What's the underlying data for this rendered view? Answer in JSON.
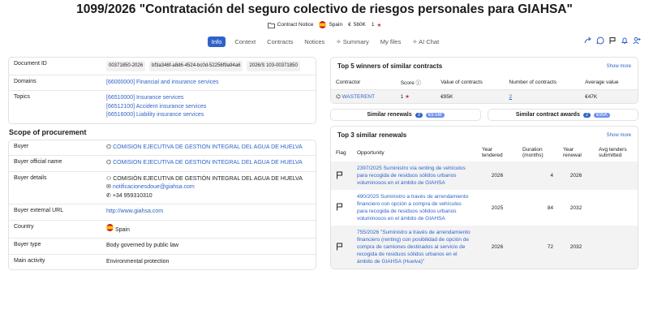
{
  "title": "1099/2026 \"Contratación del seguro colectivo de riesgos personales para GIAHSA\"",
  "meta": {
    "type": "Contract Notice",
    "country": "Spain",
    "value": "560K",
    "score": "1"
  },
  "tabs": [
    "Info",
    "Context",
    "Contracts",
    "Notices",
    "Summary",
    "My files",
    "AI Chat"
  ],
  "details": {
    "document_id": {
      "label": "Document ID",
      "ids": [
        "00371850-2026",
        "bf3a346f-a8d6-4524-bc0d-52256f9a94a6",
        "2026/S 103-00371850"
      ]
    },
    "domains": {
      "label": "Domains",
      "value": "[66000000] Financial and insurance services"
    },
    "topics": {
      "label": "Topics",
      "values": [
        "[66510000] Insurance services",
        "[66512100] Accident insurance services",
        "[66516000] Liability insurance services"
      ]
    }
  },
  "scope": {
    "title": "Scope of procurement",
    "buyer": {
      "label": "Buyer",
      "value": "COMISION EJECUTIVA DE GESTION INTEGRAL DEL AGUA DE HUELVA"
    },
    "buyer_official": {
      "label": "Buyer official name",
      "value": "COMISION EJECUTIVA DE GESTION INTEGRAL DEL AGUA DE HUELVA"
    },
    "buyer_details": {
      "label": "Buyer details",
      "name": "COMISIÓN EJECUTIVA DE GESTIÓN INTEGRAL DEL AGUA DE HUELVA",
      "email": "notificacionesdoue@giahsa.com",
      "phone": "+34 959310310"
    },
    "buyer_url": {
      "label": "Buyer external URL",
      "value": "http://www.giahsa.com"
    },
    "country": {
      "label": "Country",
      "value": "Spain"
    },
    "buyer_type": {
      "label": "Buyer type",
      "value": "Body governed by public law"
    },
    "activity": {
      "label": "Main activity",
      "value": "Environmental protection"
    }
  },
  "winners": {
    "title": "Top 5 winners of similar contracts",
    "show_more": "Show more",
    "columns": [
      "Contractor",
      "Score",
      "Value of contracts",
      "Number of contracts",
      "Average value"
    ],
    "rows": [
      {
        "contractor": "WASTERENT",
        "score": "1",
        "value": "€95K",
        "count": "2",
        "avg": "€47K"
      }
    ]
  },
  "similar": {
    "renewals": {
      "label": "Similar renewals",
      "count": "3",
      "amount": "€9.5M"
    },
    "awards": {
      "label": "Similar contract awards",
      "count": "2",
      "amount": "€95K"
    }
  },
  "renewals": {
    "title": "Top 3 similar renewals",
    "show_more": "Show more",
    "columns": [
      "Flag",
      "Opportunity",
      "Year tendered",
      "Duration (months)",
      "Year renewal",
      "Avg tenders submitted"
    ],
    "rows": [
      {
        "opportunity": "2397/2025 Suministro vía renting de vehículos para recogida de residuos sólidos urbanos voluminosos en el ámbito de GIAHSA",
        "year": "2026",
        "duration": "4",
        "renewal": "2026",
        "avg": ""
      },
      {
        "opportunity": "490/2025 Suministro a través de arrendamiento financiero con opción a compra de vehículos para recogida de residuos sólidos urbanos voluminosos en el ámbito de GIAHSA",
        "year": "2025",
        "duration": "84",
        "renewal": "2032",
        "avg": ""
      },
      {
        "opportunity": "755/2026 \"Suministro a través de arrendamiento financiero (renting) con posibilidad de opción de compra de camiones destinados al servicio de recogida de residuos sólidos urbanos en el ámbito de GIAHSA (Huelva)\"",
        "year": "2026",
        "duration": "72",
        "renewal": "2032",
        "avg": ""
      }
    ]
  },
  "icons": {
    "accent": "#2f63c9",
    "star": "#d32f2f"
  }
}
